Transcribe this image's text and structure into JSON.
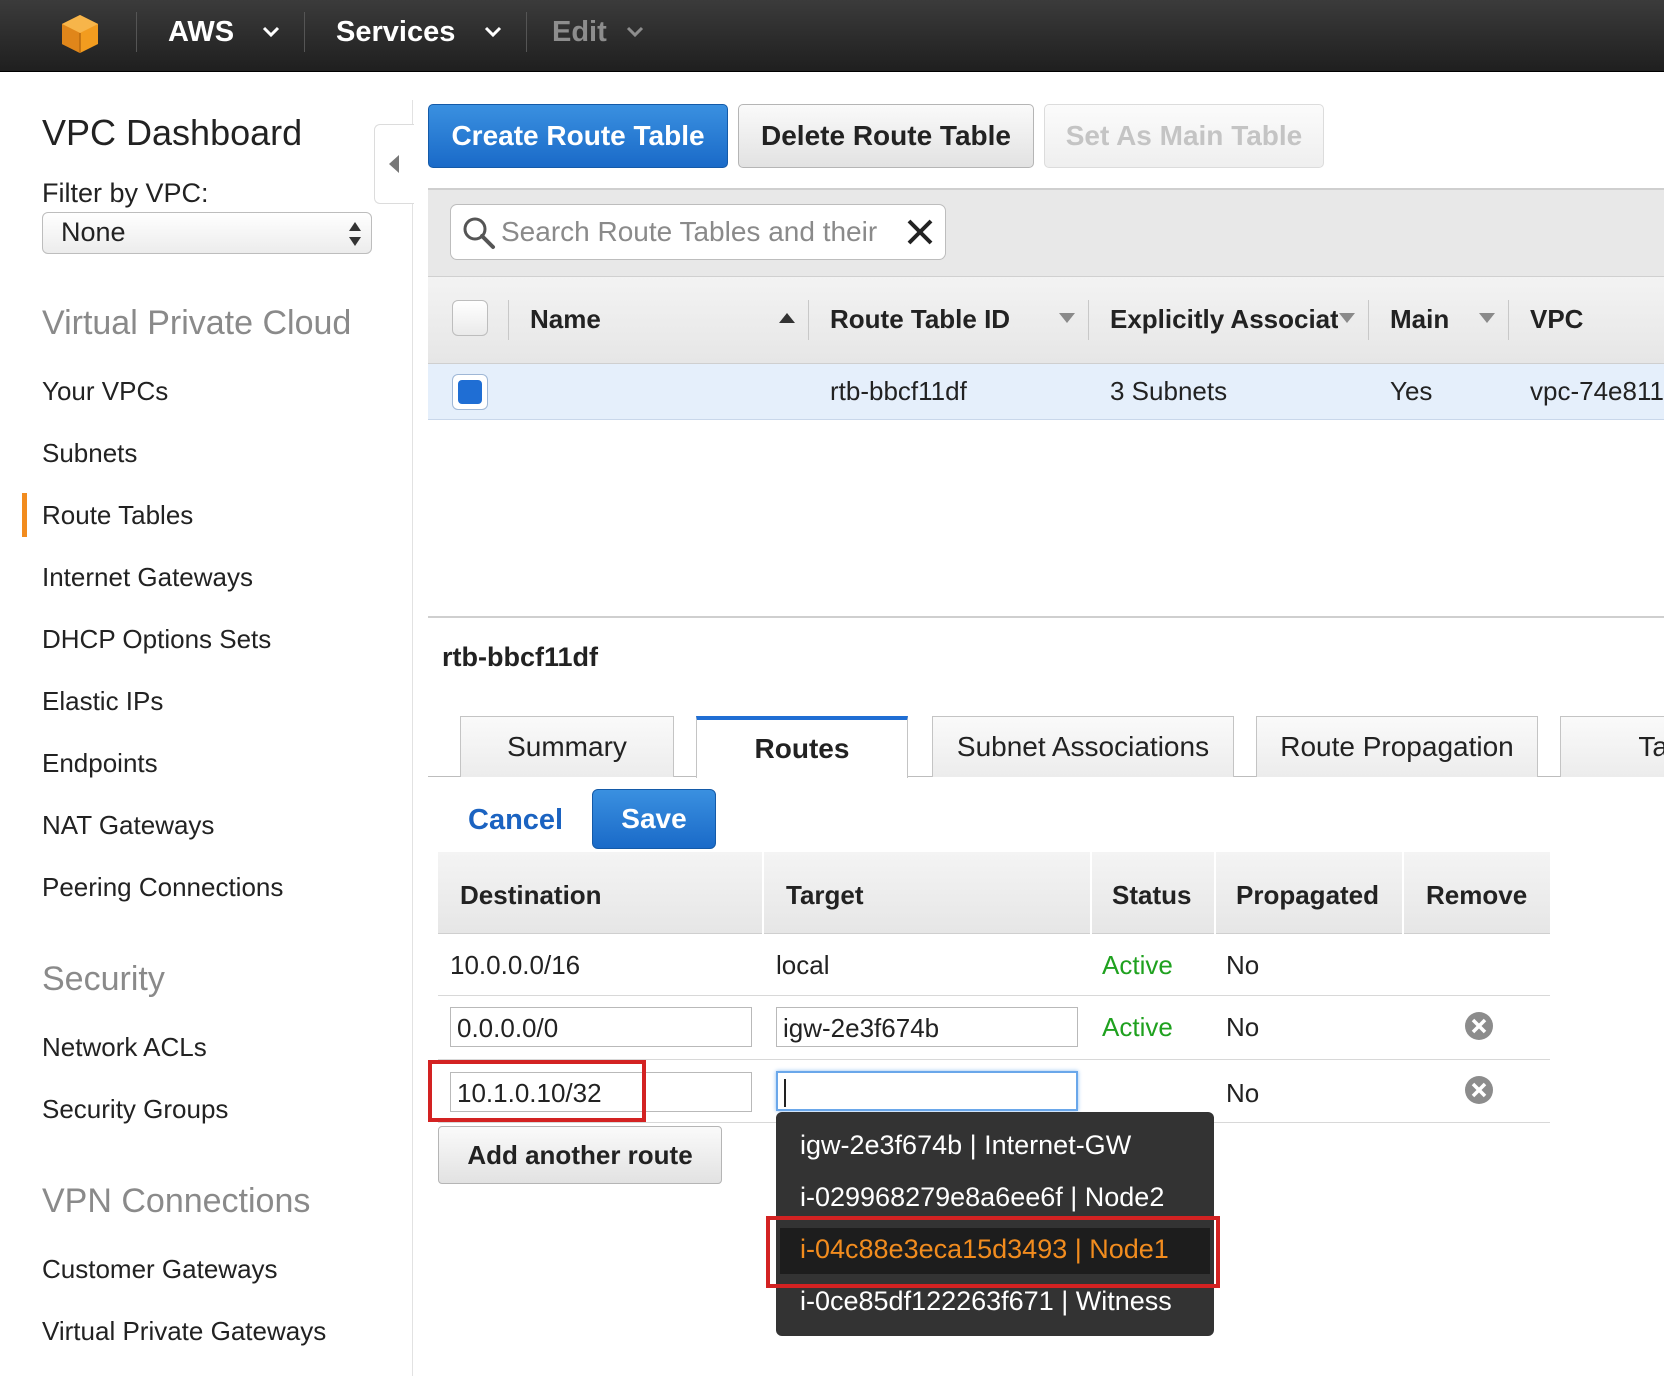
{
  "topbar": {
    "brand": "AWS",
    "services": "Services",
    "edit": "Edit"
  },
  "sidebar": {
    "title": "VPC Dashboard",
    "filter_label": "Filter by VPC:",
    "filter_value": "None",
    "sections": [
      {
        "title": "Virtual Private Cloud",
        "items": [
          "Your VPCs",
          "Subnets",
          "Route Tables",
          "Internet Gateways",
          "DHCP Options Sets",
          "Elastic IPs",
          "Endpoints",
          "NAT Gateways",
          "Peering Connections"
        ]
      },
      {
        "title": "Security",
        "items": [
          "Network ACLs",
          "Security Groups"
        ]
      },
      {
        "title": "VPN Connections",
        "items": [
          "Customer Gateways",
          "Virtual Private Gateways"
        ]
      }
    ],
    "active_item": "Route Tables"
  },
  "toolbar": {
    "create": "Create Route Table",
    "delete": "Delete Route Table",
    "set_main": "Set As Main Table"
  },
  "search": {
    "placeholder": "Search Route Tables and their"
  },
  "grid": {
    "columns": [
      "Name",
      "Route Table ID",
      "Explicitly Associat",
      "Main",
      "VPC"
    ],
    "rows": [
      {
        "name": "",
        "id": "rtb-bbcf11df",
        "assoc": "3 Subnets",
        "main": "Yes",
        "vpc": "vpc-74e811"
      }
    ]
  },
  "detail": {
    "id": "rtb-bbcf11df",
    "tabs": [
      "Summary",
      "Routes",
      "Subnet Associations",
      "Route Propagation",
      "Ta"
    ],
    "active_tab": "Routes",
    "cancel": "Cancel",
    "save": "Save"
  },
  "routes": {
    "columns": [
      "Destination",
      "Target",
      "Status",
      "Propagated",
      "Remove"
    ],
    "rows": [
      {
        "destination": "10.0.0.0/16",
        "target": "local",
        "status": "Active",
        "propagated": "No"
      },
      {
        "destination": "0.0.0.0/0",
        "target": "igw-2e3f674b",
        "status": "Active",
        "propagated": "No"
      },
      {
        "destination": "10.1.0.10/32",
        "target": "",
        "status": "",
        "propagated": "No"
      }
    ],
    "add_route": "Add another route"
  },
  "dropdown": {
    "options": [
      "igw-2e3f674b | Internet-GW",
      "i-029968279e8a6ee6f | Node2",
      "i-04c88e3eca15d3493 | Node1",
      "i-0ce85df122263f671 | Witness"
    ],
    "highlighted": "i-04c88e3eca15d3493 | Node1"
  },
  "colors": {
    "accent_orange": "#f28c1e",
    "primary_blue": "#1f6ed4",
    "active_green": "#1fa11f",
    "annotation_red": "#d32222"
  }
}
